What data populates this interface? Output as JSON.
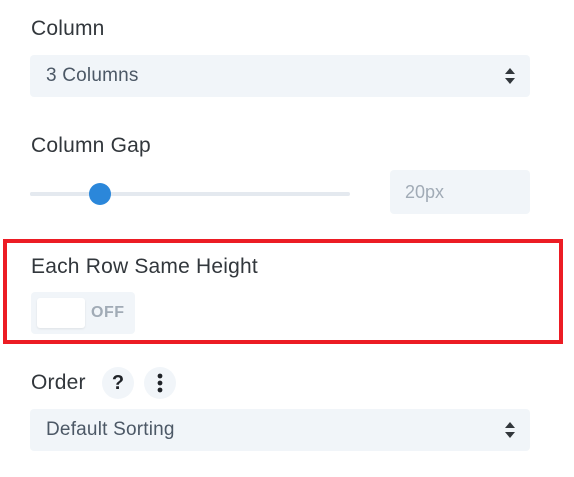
{
  "column": {
    "label": "Column",
    "select_value": "3 Columns"
  },
  "column_gap": {
    "label": "Column Gap",
    "slider_fraction": 0.22,
    "value": "20px"
  },
  "each_row_same_height": {
    "label": "Each Row Same Height",
    "toggle_state": "OFF"
  },
  "order": {
    "label": "Order",
    "help_glyph": "?",
    "select_value": "Default Sorting"
  },
  "colors": {
    "accent": "#2b87da",
    "highlight_border": "#ec1c24",
    "field_bg": "#f1f5f9"
  },
  "icons": {
    "select_arrows": "sort-arrows-icon",
    "help": "question-icon",
    "more": "vertical-dots-icon"
  }
}
